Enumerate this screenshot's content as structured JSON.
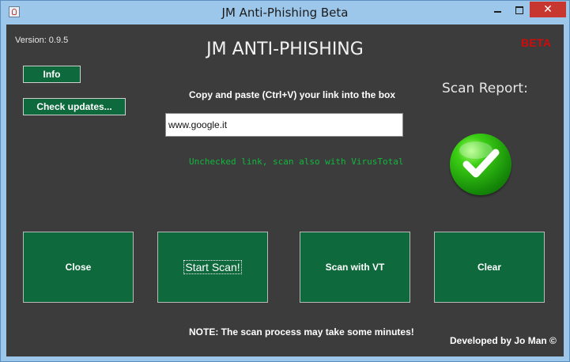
{
  "window": {
    "title": "JM Anti-Phishing Beta",
    "controls": {
      "minimize": "",
      "maximize": "",
      "close": "✕"
    }
  },
  "header": {
    "version": "Version: 0.9.5",
    "app_title": "JM ANTI-PHISHING",
    "beta": "BETA"
  },
  "buttons": {
    "info": "Info",
    "check_updates": "Check updates..."
  },
  "main": {
    "instruction": "Copy and paste (Ctrl+V) your link into the box",
    "link_value": "www.google.it",
    "status": "Unchecked link, scan also with VirusTotal"
  },
  "report": {
    "title": "Scan Report:",
    "icon": "green-check-icon"
  },
  "actions": [
    {
      "label": "Close"
    },
    {
      "label": "Start Scan!"
    },
    {
      "label": "Scan with VT"
    },
    {
      "label": "Clear"
    }
  ],
  "footer": {
    "note": "NOTE: The scan process may take some minutes!",
    "credit": "Developed by Jo Man ©"
  },
  "colors": {
    "panel_background": "#3c3c3c",
    "button_green": "#0e6a3c",
    "status_green": "#11b73d",
    "beta_red": "#d10b0b",
    "titlebar_blue": "#9cc6ea",
    "close_red": "#c7372f"
  }
}
